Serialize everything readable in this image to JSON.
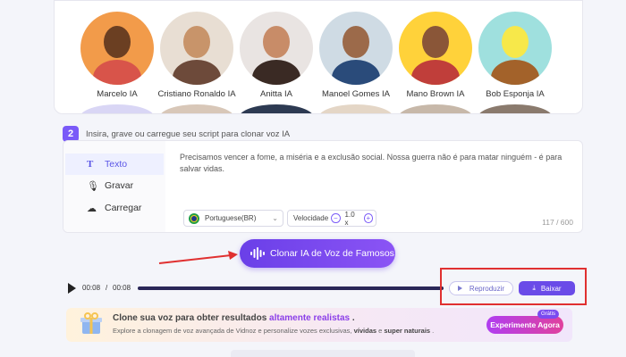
{
  "voices": [
    {
      "name": "Marcelo IA",
      "bg": "#f29b4a",
      "skin": "#6b3f22",
      "shirt": "#d8544a"
    },
    {
      "name": "Cristiano Ronaldo IA",
      "bg": "#e8ded3",
      "skin": "#c8946a",
      "shirt": "#6d4a3a"
    },
    {
      "name": "Anitta IA",
      "bg": "#e9e4e2",
      "skin": "#c88c68",
      "shirt": "#3a2a24"
    },
    {
      "name": "Manoel Gomes IA",
      "bg": "#cfdbe4",
      "skin": "#9c6a4a",
      "shirt": "#2a4b7a"
    },
    {
      "name": "Mano Brown IA",
      "bg": "#ffd23a",
      "skin": "#8a5638",
      "shirt": "#c03e3a"
    },
    {
      "name": "Bob Esponja IA",
      "bg": "#9fe0de",
      "skin": "#f7e84a",
      "shirt": "#a3622a"
    }
  ],
  "step2": {
    "number": "2",
    "text": "Insira, grave ou carregue seu script para clonar voz IA"
  },
  "modes": [
    {
      "icon": "T",
      "label": "Texto",
      "active": true
    },
    {
      "icon": "🎙",
      "label": "Gravar",
      "active": false
    },
    {
      "icon": "☁",
      "label": "Carregar",
      "active": false
    }
  ],
  "script": {
    "text": "Precisamos vencer a fome, a miséria e a exclusão social. Nossa guerra não é para matar ninguém - é para salvar vidas.",
    "language": "Portuguese(BR)",
    "speed_label": "Velocidade",
    "speed_value": "1.0 x",
    "char_count": "117 / 600"
  },
  "clone_button": "Clonar IA de Voz de Famosos",
  "player": {
    "current": "00:08",
    "separator": "/",
    "total": "00:08",
    "progress": 1.0,
    "play_label": "Reproduzir",
    "download_label": "Baixar"
  },
  "promo": {
    "title_pre": "Clone sua voz para obter resultados ",
    "title_hl": "altamente realistas",
    "title_post": " .",
    "sub_pre": "Explore a clonagem de voz avançada de Vidnoz e personalize vozes exclusivas, ",
    "sub_b1": "vívidas",
    "sub_mid": " e ",
    "sub_b2": "super naturais",
    "sub_post": " .",
    "button": "Experimente Agora",
    "badge": "Grátis"
  },
  "colors": {
    "accent": "#6a4be8",
    "highlight_box": "#e03030",
    "arrow": "#e03030"
  }
}
